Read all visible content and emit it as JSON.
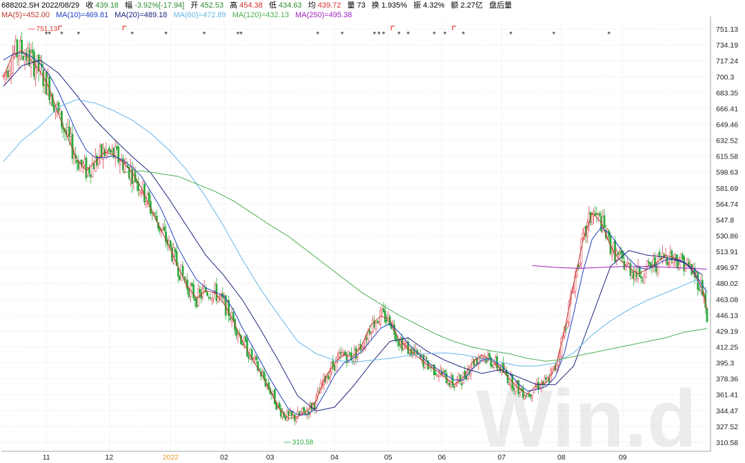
{
  "header": {
    "code_date": "688202.SH 2022/08/29",
    "quote": [
      {
        "label": "收",
        "value": "439.18",
        "color": "#2e8b2e"
      },
      {
        "label": "幅",
        "value": "-3.92%[-17.94]",
        "color": "#2e8b2e"
      },
      {
        "label": "开",
        "value": "452.53",
        "color": "#2e8b2e"
      },
      {
        "label": "高",
        "value": "454.38",
        "color": "#d32f2f"
      },
      {
        "label": "低",
        "value": "434.63",
        "color": "#2e8b2e"
      },
      {
        "label": "均",
        "value": "439.72",
        "color": "#d32f2f"
      },
      {
        "label": "量",
        "value": "73",
        "color": "#000000"
      },
      {
        "label": "换",
        "value": "1.935%",
        "color": "#000000"
      },
      {
        "label": "振",
        "value": "4.32%",
        "color": "#000000"
      },
      {
        "label": "额",
        "value": "2.27亿",
        "color": "#000000"
      }
    ],
    "tail": "盘后量"
  },
  "legend": [
    {
      "text": "MA(5)=452.00",
      "color": "#c0392b"
    },
    {
      "text": "MA(10)=469.81",
      "color": "#1f3fbf"
    },
    {
      "text": "MA(20)=489.18",
      "color": "#1a237e"
    },
    {
      "text": "MA(60)=472.89",
      "color": "#64b5e6"
    },
    {
      "text": "MA(120)=432.13",
      "color": "#4caf50"
    },
    {
      "text": "MA(250)=495.38",
      "color": "#a020c0"
    }
  ],
  "chart_data": {
    "type": "candlestick",
    "y_ticks": [
      "751.13",
      "734.19",
      "717.24",
      "700.3",
      "683.35",
      "666.41",
      "649.46",
      "632.52",
      "615.58",
      "598.63",
      "581.69",
      "564.74",
      "547.8",
      "530.86",
      "513.91",
      "496.97",
      "480.02",
      "463.08",
      "446.13",
      "429.19",
      "412.25",
      "395.3",
      "378.36",
      "361.41",
      "344.47",
      "327.52",
      "310.58"
    ],
    "ylim": [
      301,
      760
    ],
    "x_labels": [
      "11",
      "12",
      "2022",
      "02",
      "03",
      "04",
      "05",
      "06",
      "07",
      "08",
      "09"
    ],
    "x_label_highlight": "2022",
    "annotations": {
      "high": "751.13",
      "low": "310.58"
    },
    "watermark": "Win.d",
    "colors": {
      "up": "#e0424f",
      "down": "#2faa3f"
    },
    "ma_series": {
      "MA5": [
        [
          0,
          700
        ],
        [
          6,
          724
        ],
        [
          12,
          728
        ],
        [
          18,
          718
        ],
        [
          24,
          706
        ],
        [
          30,
          688
        ],
        [
          36,
          660
        ],
        [
          42,
          635
        ],
        [
          48,
          612
        ],
        [
          54,
          600
        ],
        [
          60,
          610
        ],
        [
          66,
          620
        ],
        [
          72,
          617
        ],
        [
          78,
          609
        ],
        [
          84,
          598
        ],
        [
          90,
          582
        ],
        [
          96,
          560
        ],
        [
          102,
          540
        ],
        [
          108,
          520
        ],
        [
          114,
          497
        ],
        [
          120,
          477
        ],
        [
          126,
          464
        ],
        [
          132,
          472
        ],
        [
          138,
          470
        ],
        [
          144,
          458
        ],
        [
          150,
          440
        ],
        [
          156,
          418
        ],
        [
          162,
          400
        ],
        [
          168,
          384
        ],
        [
          174,
          366
        ],
        [
          180,
          346
        ],
        [
          186,
          336
        ],
        [
          192,
          338
        ],
        [
          198,
          344
        ],
        [
          204,
          355
        ],
        [
          210,
          380
        ],
        [
          216,
          395
        ],
        [
          222,
          404
        ],
        [
          228,
          402
        ],
        [
          234,
          415
        ],
        [
          240,
          436
        ],
        [
          246,
          445
        ],
        [
          252,
          442
        ],
        [
          258,
          420
        ],
        [
          264,
          410
        ],
        [
          270,
          402
        ],
        [
          276,
          394
        ],
        [
          282,
          388
        ],
        [
          288,
          380
        ],
        [
          294,
          372
        ],
        [
          300,
          380
        ],
        [
          306,
          396
        ],
        [
          312,
          404
        ],
        [
          318,
          398
        ],
        [
          324,
          390
        ],
        [
          330,
          378
        ],
        [
          336,
          368
        ],
        [
          342,
          362
        ],
        [
          348,
          372
        ],
        [
          354,
          374
        ],
        [
          360,
          390
        ],
        [
          366,
          430
        ],
        [
          372,
          480
        ],
        [
          378,
          525
        ],
        [
          384,
          555
        ],
        [
          390,
          545
        ],
        [
          396,
          520
        ],
        [
          402,
          505
        ],
        [
          408,
          497
        ],
        [
          414,
          490
        ],
        [
          420,
          495
        ],
        [
          426,
          502
        ],
        [
          432,
          510
        ],
        [
          438,
          507
        ],
        [
          444,
          503
        ],
        [
          450,
          492
        ],
        [
          456,
          474
        ],
        [
          459,
          452
        ]
      ],
      "MA10": [
        [
          0,
          718
        ],
        [
          6,
          724
        ],
        [
          12,
          726
        ],
        [
          18,
          722
        ],
        [
          24,
          714
        ],
        [
          30,
          702
        ],
        [
          36,
          684
        ],
        [
          42,
          662
        ],
        [
          48,
          640
        ],
        [
          54,
          622
        ],
        [
          60,
          614
        ],
        [
          66,
          614
        ],
        [
          72,
          616
        ],
        [
          78,
          611
        ],
        [
          84,
          604
        ],
        [
          90,
          594
        ],
        [
          96,
          578
        ],
        [
          102,
          562
        ],
        [
          108,
          541
        ],
        [
          114,
          518
        ],
        [
          120,
          500
        ],
        [
          126,
          484
        ],
        [
          132,
          475
        ],
        [
          138,
          471
        ],
        [
          144,
          466
        ],
        [
          150,
          452
        ],
        [
          156,
          432
        ],
        [
          162,
          414
        ],
        [
          168,
          396
        ],
        [
          174,
          378
        ],
        [
          180,
          362
        ],
        [
          186,
          346
        ],
        [
          192,
          340
        ],
        [
          198,
          340
        ],
        [
          204,
          347
        ],
        [
          210,
          364
        ],
        [
          216,
          382
        ],
        [
          222,
          395
        ],
        [
          228,
          400
        ],
        [
          234,
          408
        ],
        [
          240,
          420
        ],
        [
          246,
          432
        ],
        [
          252,
          437
        ],
        [
          258,
          428
        ],
        [
          264,
          416
        ],
        [
          270,
          406
        ],
        [
          276,
          397
        ],
        [
          282,
          390
        ],
        [
          288,
          383
        ],
        [
          294,
          377
        ],
        [
          300,
          377
        ],
        [
          306,
          389
        ],
        [
          312,
          398
        ],
        [
          318,
          400
        ],
        [
          324,
          393
        ],
        [
          330,
          384
        ],
        [
          336,
          373
        ],
        [
          342,
          365
        ],
        [
          348,
          367
        ],
        [
          354,
          370
        ],
        [
          360,
          380
        ],
        [
          366,
          406
        ],
        [
          372,
          448
        ],
        [
          378,
          492
        ],
        [
          384,
          527
        ],
        [
          390,
          540
        ],
        [
          396,
          532
        ],
        [
          402,
          518
        ],
        [
          408,
          506
        ],
        [
          414,
          497
        ],
        [
          420,
          495
        ],
        [
          426,
          500
        ],
        [
          432,
          505
        ],
        [
          438,
          506
        ],
        [
          444,
          503
        ],
        [
          450,
          493
        ],
        [
          456,
          478
        ],
        [
          459,
          470
        ]
      ],
      "MA20": [
        [
          0,
          690
        ],
        [
          12,
          712
        ],
        [
          24,
          718
        ],
        [
          36,
          704
        ],
        [
          48,
          680
        ],
        [
          60,
          654
        ],
        [
          72,
          634
        ],
        [
          84,
          615
        ],
        [
          96,
          598
        ],
        [
          108,
          570
        ],
        [
          120,
          540
        ],
        [
          132,
          510
        ],
        [
          144,
          488
        ],
        [
          156,
          462
        ],
        [
          168,
          430
        ],
        [
          180,
          396
        ],
        [
          192,
          360
        ],
        [
          204,
          344
        ],
        [
          216,
          348
        ],
        [
          228,
          370
        ],
        [
          240,
          395
        ],
        [
          252,
          418
        ],
        [
          264,
          422
        ],
        [
          276,
          408
        ],
        [
          288,
          398
        ],
        [
          300,
          390
        ],
        [
          312,
          384
        ],
        [
          324,
          388
        ],
        [
          336,
          380
        ],
        [
          348,
          372
        ],
        [
          360,
          372
        ],
        [
          372,
          392
        ],
        [
          384,
          445
        ],
        [
          396,
          498
        ],
        [
          408,
          515
        ],
        [
          420,
          510
        ],
        [
          432,
          508
        ],
        [
          444,
          502
        ],
        [
          456,
          489
        ]
      ],
      "MA60": [
        [
          0,
          610
        ],
        [
          12,
          632
        ],
        [
          24,
          648
        ],
        [
          36,
          668
        ],
        [
          48,
          676
        ],
        [
          60,
          672
        ],
        [
          72,
          664
        ],
        [
          84,
          654
        ],
        [
          96,
          640
        ],
        [
          108,
          622
        ],
        [
          120,
          600
        ],
        [
          132,
          572
        ],
        [
          144,
          540
        ],
        [
          156,
          505
        ],
        [
          168,
          473
        ],
        [
          180,
          445
        ],
        [
          192,
          418
        ],
        [
          204,
          405
        ],
        [
          216,
          398
        ],
        [
          228,
          396
        ],
        [
          240,
          398
        ],
        [
          252,
          400
        ],
        [
          264,
          403
        ],
        [
          276,
          405
        ],
        [
          288,
          406
        ],
        [
          300,
          404
        ],
        [
          312,
          400
        ],
        [
          324,
          396
        ],
        [
          336,
          392
        ],
        [
          348,
          392
        ],
        [
          360,
          395
        ],
        [
          372,
          406
        ],
        [
          384,
          425
        ],
        [
          396,
          440
        ],
        [
          408,
          452
        ],
        [
          420,
          462
        ],
        [
          432,
          470
        ],
        [
          444,
          478
        ],
        [
          452,
          484
        ],
        [
          456,
          473
        ]
      ],
      "MA120": [
        [
          78,
          598
        ],
        [
          90,
          600
        ],
        [
          102,
          597
        ],
        [
          114,
          594
        ],
        [
          126,
          586
        ],
        [
          138,
          578
        ],
        [
          150,
          568
        ],
        [
          162,
          555
        ],
        [
          174,
          542
        ],
        [
          186,
          530
        ],
        [
          198,
          515
        ],
        [
          210,
          500
        ],
        [
          222,
          485
        ],
        [
          234,
          470
        ],
        [
          246,
          458
        ],
        [
          258,
          446
        ],
        [
          270,
          436
        ],
        [
          282,
          426
        ],
        [
          294,
          418
        ],
        [
          306,
          412
        ],
        [
          318,
          408
        ],
        [
          330,
          405
        ],
        [
          342,
          400
        ],
        [
          354,
          397
        ],
        [
          360,
          398
        ],
        [
          372,
          402
        ],
        [
          384,
          406
        ],
        [
          396,
          410
        ],
        [
          408,
          414
        ],
        [
          420,
          418
        ],
        [
          432,
          422
        ],
        [
          444,
          428
        ],
        [
          456,
          431
        ],
        [
          459,
          432
        ]
      ],
      "MA250": [
        [
          345,
          499
        ],
        [
          360,
          497
        ],
        [
          375,
          496
        ],
        [
          390,
          497
        ],
        [
          405,
          498
        ],
        [
          420,
          498
        ],
        [
          435,
          497
        ],
        [
          450,
          496
        ],
        [
          459,
          495
        ]
      ]
    }
  }
}
